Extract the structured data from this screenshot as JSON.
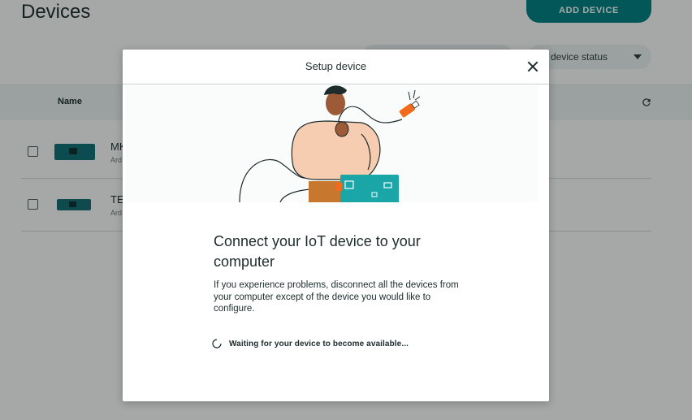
{
  "page": {
    "title": "Devices",
    "add_button": "ADD DEVICE",
    "status_filter": "device status",
    "table": {
      "columns": [
        "Name"
      ],
      "rows": [
        {
          "name": "MK",
          "sub": "Ard"
        },
        {
          "name": "TE",
          "sub": "Ard"
        }
      ]
    }
  },
  "modal": {
    "title": "Setup device",
    "heading": "Connect your IoT device to your computer",
    "body": "If you experience problems, disconnect all the devices from your computer except of the device you would like to configure.",
    "status": "Waiting for your device to become available..."
  },
  "icons": {
    "close": "close-icon",
    "refresh": "refresh-icon",
    "spinner": "spinner-icon",
    "caret": "chevron-down-icon"
  },
  "colors": {
    "accent": "#008184",
    "overlay": "rgba(8,14,15,0.36)",
    "plug": "#f26a1b",
    "board": "#1aa5a7"
  }
}
